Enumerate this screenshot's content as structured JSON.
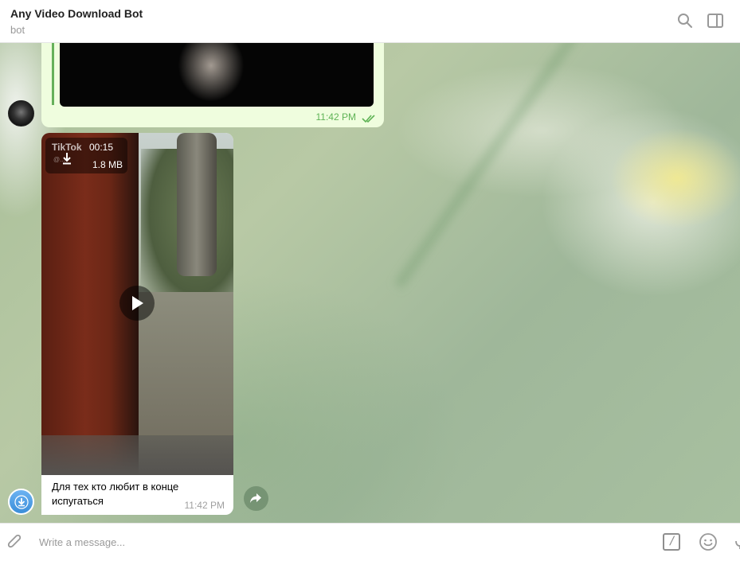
{
  "header": {
    "title": "Any Video Download Bot",
    "subtitle": "bot"
  },
  "previous_message": {
    "time": "11:42 PM",
    "status": "read"
  },
  "video_message": {
    "watermark": "TikTok",
    "watermark_sub": "@...",
    "duration": "00:15",
    "size": "1.8 MB",
    "caption": "Для тех кто любит в конце испугаться",
    "time": "11:42 PM"
  },
  "composer": {
    "placeholder": "Write a message..."
  },
  "colors": {
    "outgoing_bubble": "#effdde",
    "accent_green": "#5fb356",
    "avatar_blue": "#4fa0e8"
  },
  "icons": [
    "search-icon",
    "sidebar-toggle-icon",
    "paperclip-icon",
    "bot-command-icon",
    "emoji-icon",
    "microphone-icon",
    "download-icon",
    "play-icon",
    "share-icon",
    "double-check-icon"
  ]
}
